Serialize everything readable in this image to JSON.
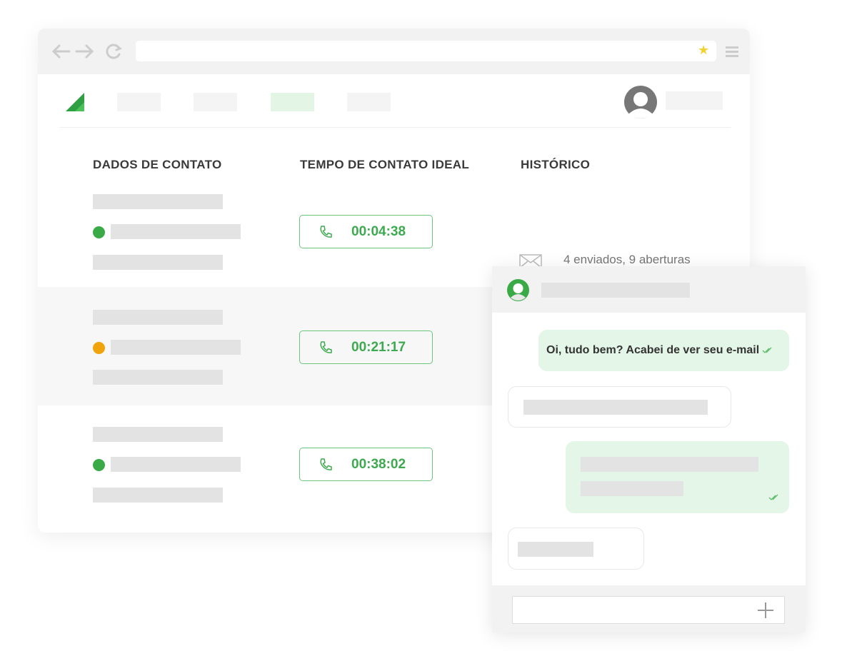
{
  "table": {
    "headers": [
      "DADOS DE CONTATO",
      "TEMPO DE CONTATO IDEAL",
      "HISTÓRICO"
    ],
    "rows": [
      {
        "status_color": "#3aaa47",
        "timer": "00:04:38",
        "history": "4 enviados, 9 aberturas"
      },
      {
        "status_color": "#f0a30a",
        "timer": "00:21:17"
      },
      {
        "status_color": "#3aaa47",
        "timer": "00:38:02"
      }
    ]
  },
  "chat": {
    "messages": [
      {
        "text": "Oi, tudo bem? Acabei de ver seu e-mail"
      }
    ]
  },
  "colors": {
    "accent": "#3daa4f",
    "bubble_out": "#e4f6e7"
  }
}
